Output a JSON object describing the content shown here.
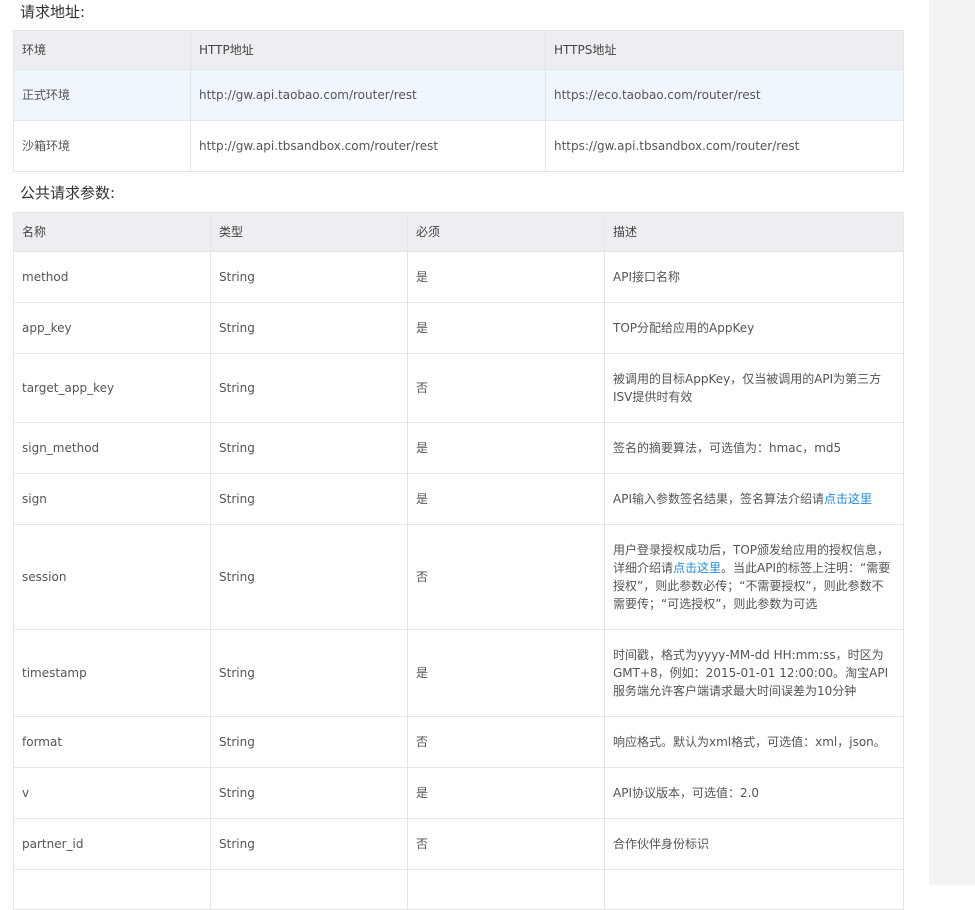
{
  "address_section": {
    "title": "请求地址:",
    "headers": [
      "环境",
      "HTTP地址",
      "HTTPS地址"
    ],
    "rows": [
      [
        "正式环境",
        "http://gw.api.taobao.com/router/rest",
        "https://eco.taobao.com/router/rest"
      ],
      [
        "沙箱环境",
        "http://gw.api.tbsandbox.com/router/rest",
        "https://gw.api.tbsandbox.com/router/rest"
      ]
    ]
  },
  "params_section": {
    "title": "公共请求参数:",
    "headers": [
      "名称",
      "类型",
      "必须",
      "描述"
    ],
    "rows": [
      {
        "name": "method",
        "type": "String",
        "required": "是",
        "desc": "API接口名称"
      },
      {
        "name": "app_key",
        "type": "String",
        "required": "是",
        "desc": "TOP分配给应用的AppKey"
      },
      {
        "name": "target_app_key",
        "type": "String",
        "required": "否",
        "desc": "被调用的目标AppKey，仅当被调用的API为第三方ISV提供时有效"
      },
      {
        "name": "sign_method",
        "type": "String",
        "required": "是",
        "desc": "签名的摘要算法，可选值为：hmac，md5"
      },
      {
        "name": "sign",
        "type": "String",
        "required": "是",
        "desc_a": "API输入参数签名结果，签名算法介绍请",
        "desc_link": "点击这里"
      },
      {
        "name": "session",
        "type": "String",
        "required": "否",
        "desc_a": "用户登录授权成功后，TOP颁发给应用的授权信息，详细介绍请",
        "desc_link": "点击这里",
        "desc_b": "。当此API的标签上注明：“需要授权”，则此参数必传；“不需要授权”，则此参数不需要传；“可选授权”，则此参数为可选"
      },
      {
        "name": "timestamp",
        "type": "String",
        "required": "是",
        "desc": "时间戳，格式为yyyy-MM-dd HH:mm:ss，时区为GMT+8，例如：2015-01-01 12:00:00。淘宝API服务端允许客户端请求最大时间误差为10分钟"
      },
      {
        "name": "format",
        "type": "String",
        "required": "否",
        "desc": "响应格式。默认为xml格式，可选值：xml，json。"
      },
      {
        "name": "v",
        "type": "String",
        "required": "是",
        "desc": "API协议版本，可选值：2.0"
      },
      {
        "name": "partner_id",
        "type": "String",
        "required": "否",
        "desc": "合作伙伴身份标识"
      }
    ]
  },
  "colors": {
    "link": "#1d8ce0",
    "header_bg": "#eceef1",
    "highlight_row_bg": "#f0f6fd",
    "right_panel_bg": "#f2f3f5"
  }
}
